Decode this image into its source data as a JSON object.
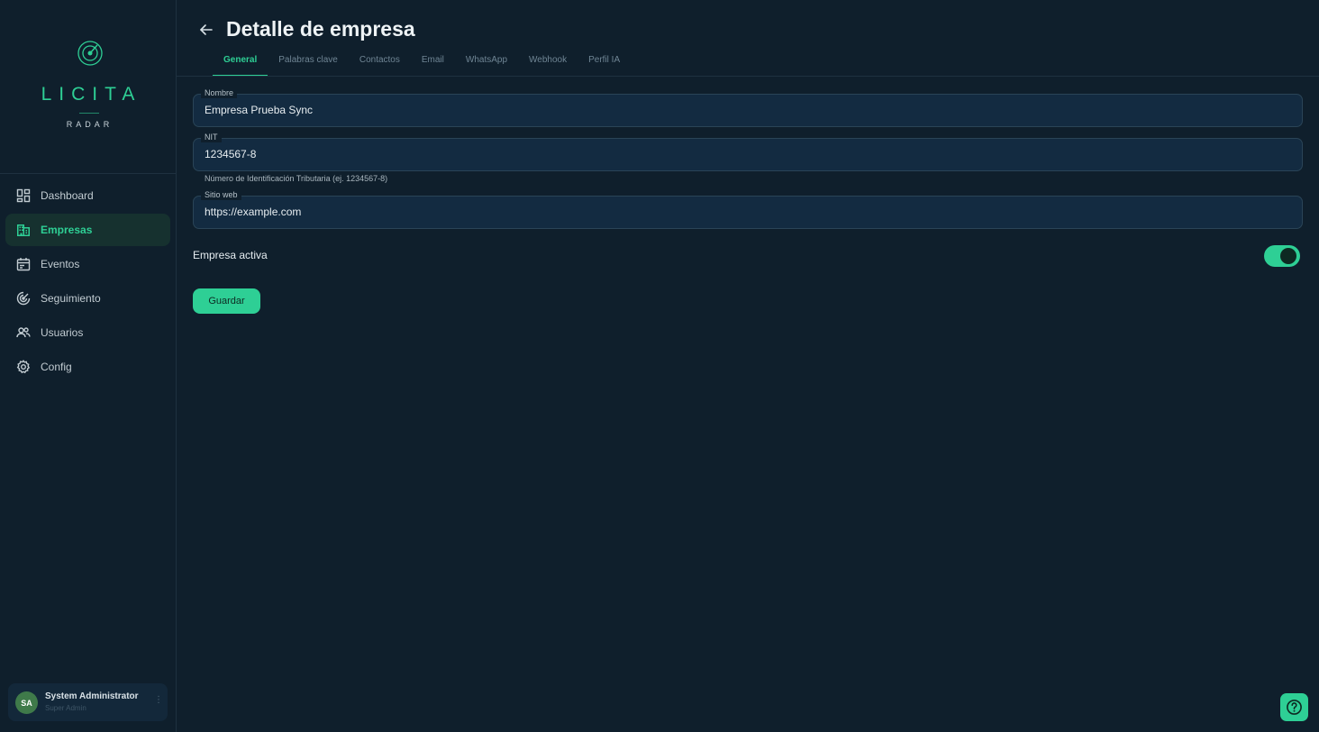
{
  "brand": {
    "name": "LICITA",
    "sub": "RADAR",
    "accent": "#2ecf95"
  },
  "sidebar": {
    "items": [
      {
        "label": "Dashboard",
        "icon": "dashboard-icon",
        "active": false
      },
      {
        "label": "Empresas",
        "icon": "building-icon",
        "active": true
      },
      {
        "label": "Eventos",
        "icon": "calendar-icon",
        "active": false
      },
      {
        "label": "Seguimiento",
        "icon": "radar-icon",
        "active": false
      },
      {
        "label": "Usuarios",
        "icon": "users-icon",
        "active": false
      },
      {
        "label": "Config",
        "icon": "gear-icon",
        "active": false
      }
    ],
    "user": {
      "initials": "SA",
      "name": "System Administrator",
      "role": "Super Admin"
    }
  },
  "header": {
    "title": "Detalle de empresa"
  },
  "tabs": [
    {
      "label": "General",
      "active": true
    },
    {
      "label": "Palabras clave",
      "active": false
    },
    {
      "label": "Contactos",
      "active": false
    },
    {
      "label": "Email",
      "active": false
    },
    {
      "label": "WhatsApp",
      "active": false
    },
    {
      "label": "Webhook",
      "active": false
    },
    {
      "label": "Perfil IA",
      "active": false
    }
  ],
  "form": {
    "nombre": {
      "label": "Nombre",
      "value": "Empresa Prueba Sync"
    },
    "nit": {
      "label": "NIT",
      "value": "1234567-8",
      "helper": "Número de Identificación Tributaria (ej. 1234567-8)"
    },
    "sitio": {
      "label": "Sitio web",
      "value": "https://example.com"
    },
    "activa": {
      "label": "Empresa activa",
      "checked": true
    },
    "save_label": "Guardar"
  }
}
